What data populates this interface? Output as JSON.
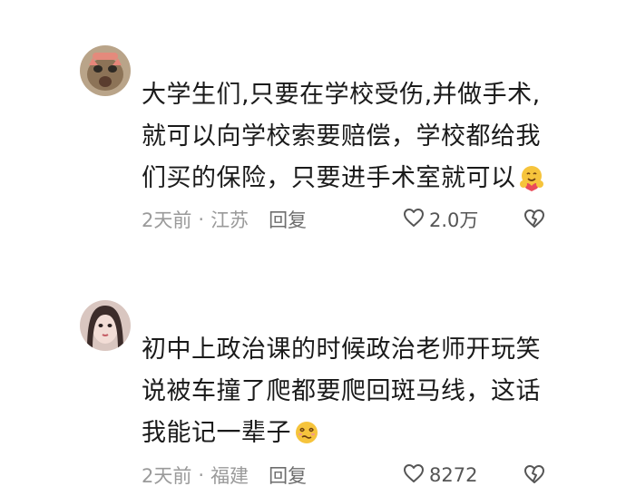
{
  "comments": [
    {
      "lines": [
        "大学生们,只要在学校受伤,并做手术,",
        "就可以向学校索要赔偿，学校都给我",
        "们买的保险，只要进手术室就可以"
      ],
      "time": "2天前",
      "separator": "·",
      "location": "江苏",
      "reply_label": "回复",
      "likes": "2.0万"
    },
    {
      "lines": [
        "初中上政治课的时候政治老师开玩笑",
        "说被车撞了爬都要爬回斑马线，这话",
        "我能记一辈子"
      ],
      "time": "2天前",
      "separator": "·",
      "location": "福建",
      "reply_label": "回复",
      "likes": "8272"
    }
  ],
  "icons": {
    "like": "heart-outline-icon",
    "dislike": "broken-heart-icon",
    "emoji_1": "hug-emoji",
    "emoji_2": "dizzy-face-emoji"
  },
  "colors": {
    "text": "#1a1a1a",
    "meta": "#9a9a9a",
    "emoji": "#f6c43c"
  }
}
